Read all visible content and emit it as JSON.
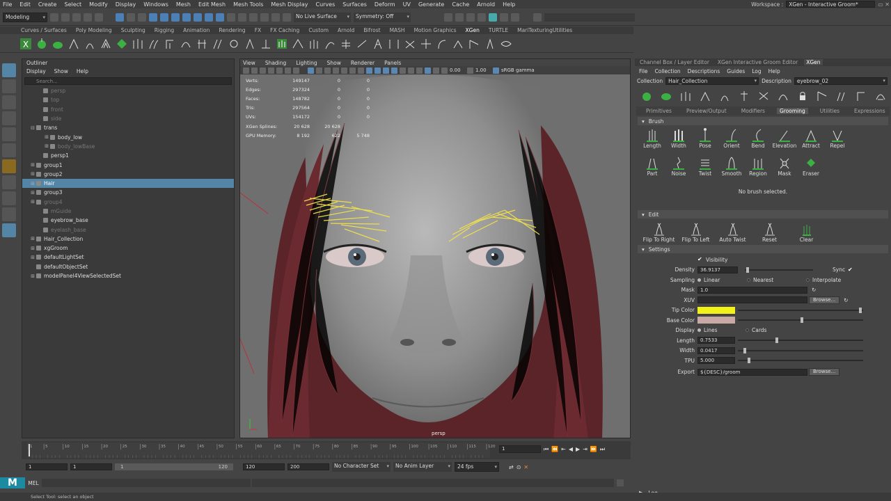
{
  "menubar": [
    "File",
    "Edit",
    "Create",
    "Select",
    "Modify",
    "Display",
    "Windows",
    "Mesh",
    "Edit Mesh",
    "Mesh Tools",
    "Mesh Display",
    "Curves",
    "Surfaces",
    "Deform",
    "UV",
    "Generate",
    "Cache",
    "Arnold",
    "Help"
  ],
  "workspace": {
    "label": "Workspace :",
    "value": "XGen - Interactive Groom*"
  },
  "statusline": {
    "mode": "Modeling",
    "live_surface": "No Live Surface",
    "symmetry": "Symmetry: Off"
  },
  "shelf_tabs": [
    "Curves / Surfaces",
    "Poly Modeling",
    "Sculpting",
    "Rigging",
    "Animation",
    "Rendering",
    "FX",
    "FX Caching",
    "Custom",
    "Arnold",
    "Bifrost",
    "MASH",
    "Motion Graphics",
    "XGen",
    "TURTLE",
    "MariTexturingUtilities"
  ],
  "shelf_active": "XGen",
  "outliner": {
    "title": "Outliner",
    "menu": [
      "Display",
      "Show",
      "Help"
    ],
    "search_placeholder": "Search...",
    "items": [
      {
        "label": "persp",
        "indent": 1,
        "dim": true,
        "exp": ""
      },
      {
        "label": "top",
        "indent": 1,
        "dim": true,
        "exp": ""
      },
      {
        "label": "front",
        "indent": 1,
        "dim": true,
        "exp": ""
      },
      {
        "label": "side",
        "indent": 1,
        "dim": true,
        "exp": ""
      },
      {
        "label": "trans",
        "indent": 0,
        "dim": false,
        "exp": "⊟"
      },
      {
        "label": "body_low",
        "indent": 2,
        "dim": false,
        "exp": "⊞"
      },
      {
        "label": "body_lowBase",
        "indent": 2,
        "dim": true,
        "exp": "⊞"
      },
      {
        "label": "persp1",
        "indent": 1,
        "dim": false,
        "exp": ""
      },
      {
        "label": "group1",
        "indent": 0,
        "dim": false,
        "exp": "⊞"
      },
      {
        "label": "group2",
        "indent": 0,
        "dim": false,
        "exp": "⊞"
      },
      {
        "label": "Hair",
        "indent": 0,
        "dim": false,
        "exp": "⊞",
        "selected": true
      },
      {
        "label": "group3",
        "indent": 0,
        "dim": false,
        "exp": "⊞"
      },
      {
        "label": "group4",
        "indent": 0,
        "dim": true,
        "exp": "⊞"
      },
      {
        "label": "mGuide",
        "indent": 1,
        "dim": true,
        "exp": ""
      },
      {
        "label": "eyebrow_base",
        "indent": 1,
        "dim": false,
        "exp": ""
      },
      {
        "label": "eyelash_base",
        "indent": 1,
        "dim": true,
        "exp": ""
      },
      {
        "label": "Hair_Collection",
        "indent": 0,
        "dim": false,
        "exp": "⊞"
      },
      {
        "label": "xgGroom",
        "indent": 0,
        "dim": false,
        "exp": "⊞"
      },
      {
        "label": "defaultLightSet",
        "indent": 0,
        "dim": false,
        "exp": "⊞"
      },
      {
        "label": "defaultObjectSet",
        "indent": 0,
        "dim": false,
        "exp": ""
      },
      {
        "label": "modelPanel4ViewSelectedSet",
        "indent": 0,
        "dim": false,
        "exp": "⊞"
      }
    ]
  },
  "viewport": {
    "menu": [
      "View",
      "Shading",
      "Lighting",
      "Show",
      "Renderer",
      "Panels"
    ],
    "exposure": "0.00",
    "gamma": "1.00",
    "colorspace": "sRGB gamma",
    "camera": "persp",
    "hud": [
      {
        "label": "Verts:",
        "v1": "149147",
        "v2": "0",
        "v3": "0"
      },
      {
        "label": "Edges:",
        "v1": "297324",
        "v2": "0",
        "v3": "0"
      },
      {
        "label": "Faces:",
        "v1": "148782",
        "v2": "0",
        "v3": "0"
      },
      {
        "label": "Tris:",
        "v1": "297564",
        "v2": "0",
        "v3": "0"
      },
      {
        "label": "UVs:",
        "v1": "154172",
        "v2": "0",
        "v3": "0"
      },
      {
        "label": "XGen Splines:",
        "v1": "20 628",
        "v2": "20 628",
        "v3": ""
      },
      {
        "label": "GPU Memory:",
        "v1": "8 192",
        "v2": "622",
        "v3": "5 748"
      }
    ]
  },
  "rpanel": {
    "tabs": [
      "Channel Box / Layer Editor",
      "XGen Interactive Groom Editor",
      "XGen"
    ],
    "active_tab": "XGen",
    "menu": [
      "File",
      "Collection",
      "Descriptions",
      "Guides",
      "Log",
      "Help"
    ],
    "collection_label": "Collection",
    "collection_value": "Hair_Collection",
    "description_label": "Description",
    "description_value": "eyebrow_02",
    "subtabs": [
      "Primitives",
      "Preview/Output",
      "Modifiers",
      "Grooming",
      "Utilities",
      "Expressions"
    ],
    "active_subtab": "Grooming",
    "brush_section": "Brush",
    "brushes": [
      "Length",
      "Width",
      "Pose",
      "Orient",
      "Bend",
      "Elevation",
      "Attract",
      "Repel",
      "Part",
      "Noise",
      "Twist",
      "Smooth",
      "Region",
      "Mask",
      "Eraser"
    ],
    "no_brush": "No brush selected.",
    "edit_section": "Edit",
    "edit_buttons": [
      "Flip To Right",
      "Flip To Left",
      "Auto Twist",
      "Reset",
      "Clear"
    ],
    "settings_section": "Settings",
    "settings": {
      "visibility": "Visibility",
      "density_label": "Density",
      "density": "36.9137",
      "sync": "Sync",
      "sampling_label": "Sampling",
      "sampling_opts": [
        "Linear",
        "Nearest",
        "Interpolate"
      ],
      "mask_label": "Mask",
      "mask": "1.0",
      "xuv_label": "XUV",
      "browse": "Browse...",
      "tip_color_label": "Tip Color",
      "tip_color": "#f2f21a",
      "base_color_label": "Base Color",
      "base_color": "#c9a9a6",
      "display_label": "Display",
      "display_opts": [
        "Lines",
        "Cards"
      ],
      "length_label": "Length",
      "length": "0.7533",
      "width_label": "Width",
      "width": "0.0417",
      "tpu_label": "TPU",
      "tpu": "5.000",
      "export_label": "Export",
      "export": "${DESC}/groom"
    },
    "log": "Log"
  },
  "timeline": {
    "ticks": [
      "1",
      "5",
      "10",
      "15",
      "20",
      "25",
      "30",
      "35",
      "40",
      "45",
      "50",
      "55",
      "60",
      "65",
      "70",
      "75",
      "80",
      "85",
      "90",
      "95",
      "100",
      "105",
      "110",
      "115",
      "120"
    ],
    "current_frame": "1"
  },
  "range": {
    "start": "1",
    "start2": "1",
    "range_start": "1",
    "range_end": "120",
    "end": "120",
    "end2": "200",
    "char_set": "No Character Set",
    "anim_layer": "No Anim Layer",
    "fps": "24 fps"
  },
  "cmdline": {
    "label": "MEL"
  },
  "helpline": "Select Tool: select an object"
}
